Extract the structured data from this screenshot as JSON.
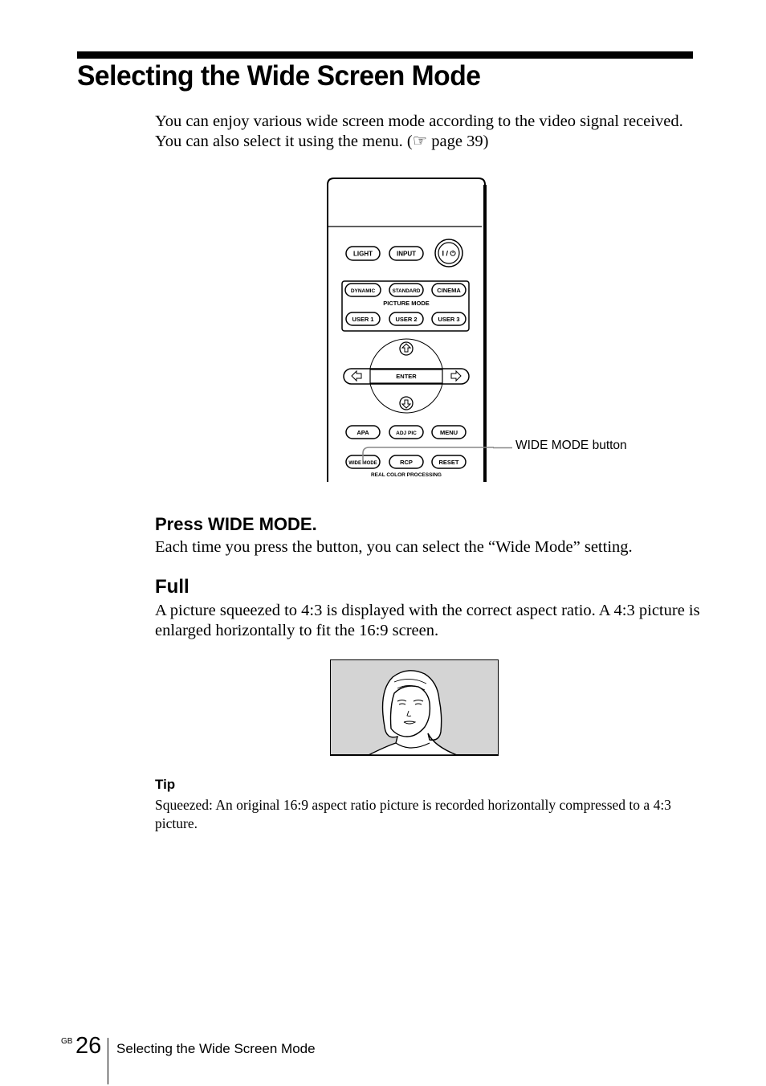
{
  "page": {
    "title": "Selecting the Wide Screen Mode",
    "intro": "You can enjoy various wide screen mode according to the video signal received. You can also select it using the menu. (☞ page 39)"
  },
  "remote": {
    "buttons": {
      "light": "LIGHT",
      "input": "INPUT",
      "power": "I / ⏻",
      "dynamic": "DYNAMIC",
      "standard": "STANDARD",
      "cinema": "CINEMA",
      "picture_mode_label": "PICTURE MODE",
      "user1": "USER 1",
      "user2": "USER 2",
      "user3": "USER 3",
      "enter": "ENTER",
      "apa": "APA",
      "adj_pic": "ADJ PIC",
      "menu": "MENU",
      "wide_mode": "WIDE MODE",
      "rcp": "RCP",
      "reset": "RESET",
      "rcp_label": "REAL COLOR PROCESSING"
    },
    "callout": "WIDE MODE button"
  },
  "step": {
    "heading": "Press WIDE MODE.",
    "text": "Each time you press the button, you can select the “Wide Mode” setting."
  },
  "full": {
    "heading": "Full",
    "text": "A picture squeezed to 4:3 is displayed with the correct aspect ratio. A 4:3 picture is enlarged horizontally to fit the 16:9 screen."
  },
  "tip": {
    "heading": "Tip",
    "text": "Squeezed: An original 16:9 aspect ratio picture is recorded horizontally compressed to a 4:3 picture."
  },
  "footer": {
    "region": "GB",
    "page_number": "26",
    "section": "Selecting the Wide Screen Mode"
  }
}
